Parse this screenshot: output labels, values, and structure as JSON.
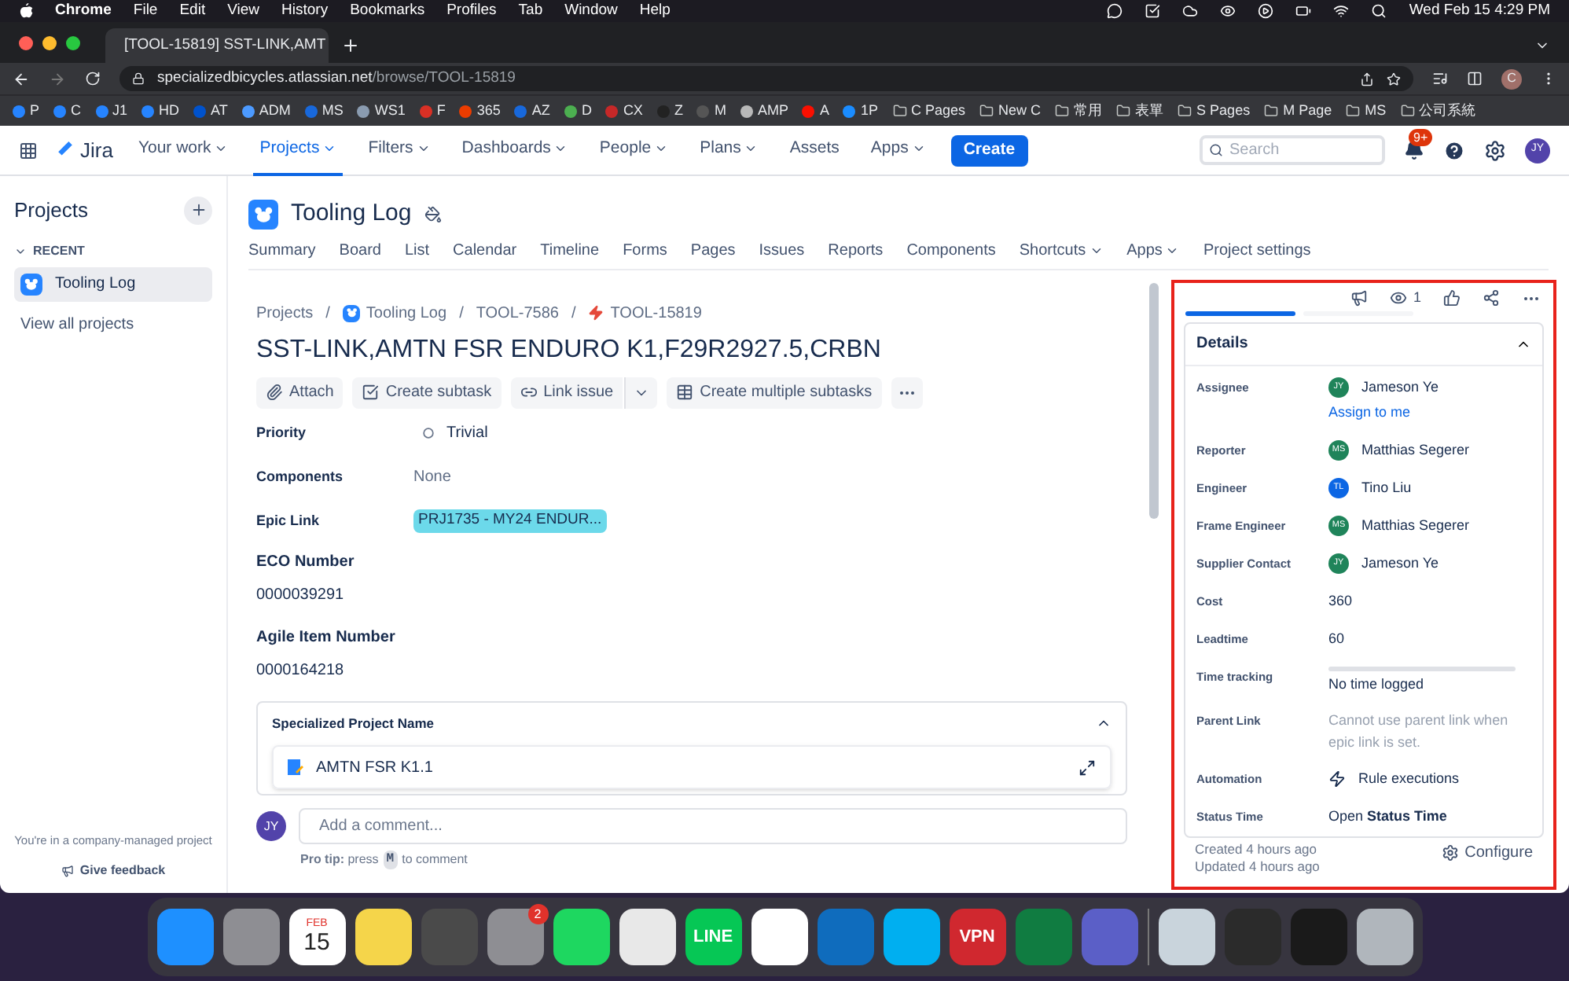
{
  "menu_bar": {
    "items": [
      "Chrome",
      "File",
      "Edit",
      "View",
      "History",
      "Bookmarks",
      "Profiles",
      "Tab",
      "Window",
      "Help"
    ],
    "clock": "Wed Feb 15  4:29 PM"
  },
  "browser": {
    "tab_title": "[TOOL-15819] SST-LINK,AMT",
    "url_host": "specializedbicycles.atlassian.net",
    "url_path": "/browse/TOOL-15819",
    "profile": "C",
    "bookmarks": [
      {
        "label": "P",
        "kind": "app",
        "color": "#2684ff"
      },
      {
        "label": "C",
        "kind": "app",
        "color": "#2684ff"
      },
      {
        "label": "J1",
        "kind": "app",
        "color": "#2684ff"
      },
      {
        "label": "HD",
        "kind": "app",
        "color": "#2684ff"
      },
      {
        "label": "AT",
        "kind": "app",
        "color": "#0052cc"
      },
      {
        "label": "ADM",
        "kind": "app",
        "color": "#4c9aff"
      },
      {
        "label": "MS",
        "kind": "app",
        "color": "#1868db"
      },
      {
        "label": "WS1",
        "kind": "app",
        "color": "#8a9bb0"
      },
      {
        "label": "F",
        "kind": "app",
        "color": "#d93025"
      },
      {
        "label": "365",
        "kind": "app",
        "color": "#eb3c00"
      },
      {
        "label": "AZ",
        "kind": "app",
        "color": "#1868db"
      },
      {
        "label": "D",
        "kind": "app",
        "color": "#4caf50"
      },
      {
        "label": "CX",
        "kind": "app",
        "color": "#c62828"
      },
      {
        "label": "Z",
        "kind": "app",
        "color": "#222222"
      },
      {
        "label": "M",
        "kind": "app",
        "color": "#555555"
      },
      {
        "label": "AMP",
        "kind": "app",
        "color": "#b8b8b8"
      },
      {
        "label": "A",
        "kind": "app",
        "color": "#fa0f00"
      },
      {
        "label": "1P",
        "kind": "app",
        "color": "#1a8cff"
      },
      {
        "label": "C Pages",
        "kind": "folder"
      },
      {
        "label": "New C",
        "kind": "folder"
      },
      {
        "label": "常用",
        "kind": "folder"
      },
      {
        "label": "表單",
        "kind": "folder"
      },
      {
        "label": "S Pages",
        "kind": "folder"
      },
      {
        "label": "M Page",
        "kind": "folder"
      },
      {
        "label": "MS",
        "kind": "folder"
      },
      {
        "label": "公司系統",
        "kind": "folder"
      }
    ]
  },
  "jira_nav": {
    "product": "Jira",
    "items": [
      {
        "label": "Your work",
        "dropdown": true,
        "selected": false
      },
      {
        "label": "Projects",
        "dropdown": true,
        "selected": true
      },
      {
        "label": "Filters",
        "dropdown": true,
        "selected": false
      },
      {
        "label": "Dashboards",
        "dropdown": true,
        "selected": false
      },
      {
        "label": "People",
        "dropdown": true,
        "selected": false
      },
      {
        "label": "Plans",
        "dropdown": true,
        "selected": false
      },
      {
        "label": "Assets",
        "dropdown": false,
        "selected": false
      },
      {
        "label": "Apps",
        "dropdown": true,
        "selected": false
      }
    ],
    "create": "Create",
    "search_placeholder": "Search",
    "notifications": "9+",
    "avatar": "JY"
  },
  "sidebar": {
    "title": "Projects",
    "section": "RECENT",
    "items": [
      {
        "label": "Tooling Log",
        "selected": true
      }
    ],
    "view_all": "View all projects",
    "footer_note": "You're in a company-managed project",
    "feedback": "Give feedback"
  },
  "project": {
    "name": "Tooling Log",
    "tabs": [
      {
        "label": "Summary",
        "dropdown": false
      },
      {
        "label": "Board",
        "dropdown": false
      },
      {
        "label": "List",
        "dropdown": false
      },
      {
        "label": "Calendar",
        "dropdown": false
      },
      {
        "label": "Timeline",
        "dropdown": false
      },
      {
        "label": "Forms",
        "dropdown": false
      },
      {
        "label": "Pages",
        "dropdown": false
      },
      {
        "label": "Issues",
        "dropdown": false
      },
      {
        "label": "Reports",
        "dropdown": false
      },
      {
        "label": "Components",
        "dropdown": false
      },
      {
        "label": "Shortcuts",
        "dropdown": true
      },
      {
        "label": "Apps",
        "dropdown": true
      },
      {
        "label": "Project settings",
        "dropdown": false
      }
    ]
  },
  "issue": {
    "breadcrumb_separator": "/",
    "breadcrumbs": [
      {
        "label": "Projects",
        "kind": "text"
      },
      {
        "label": "Tooling Log",
        "kind": "project"
      },
      {
        "label": "TOOL-7586",
        "kind": "text"
      },
      {
        "label": "TOOL-15819",
        "kind": "issue"
      }
    ],
    "title": "SST-LINK,AMTN FSR ENDURO K1,F29R2927.5,CRBN",
    "actions": [
      {
        "label": "Attach",
        "kind": "attach"
      },
      {
        "label": "Create subtask",
        "kind": "subtask"
      },
      {
        "label": "Link issue",
        "kind": "link"
      },
      {
        "label": "Create multiple subtasks",
        "kind": "multi"
      }
    ],
    "fields": [
      {
        "label": "Priority",
        "value": "Trivial",
        "kind": "priority"
      },
      {
        "label": "Components",
        "value": "None",
        "kind": "muted"
      },
      {
        "label": "Epic Link",
        "value": "PRJ1735 - MY24 ENDUR...",
        "kind": "tag",
        "color": "#6cd9ea"
      }
    ],
    "sections": [
      {
        "label": "ECO Number",
        "value": "0000039291"
      },
      {
        "label": "Agile Item Number",
        "value": "0000164218"
      }
    ],
    "panel": {
      "title": "Specialized Project Name",
      "expanded": true,
      "item": "AMTN FSR K1.1"
    },
    "comment": {
      "avatar": "JY",
      "placeholder": "Add a comment...",
      "tip": "**Pro tip:** press",
      "key": "M",
      "tip_end": "to comment"
    }
  },
  "details": {
    "watchers": "1",
    "tabs": [
      {
        "selected": true
      },
      {
        "selected": false
      }
    ],
    "title": "Details",
    "expanded": true,
    "rows": [
      {
        "label": "Assignee",
        "kind": "person",
        "value": "Jameson Ye",
        "initials": "JY",
        "color": "#1f845a",
        "link": "Assign to me"
      },
      {
        "label": "Reporter",
        "kind": "person",
        "value": "Matthias Segerer",
        "initials": "MS",
        "color": "#1f845a"
      },
      {
        "label": "Engineer",
        "kind": "person",
        "value": "Tino Liu",
        "initials": "TL",
        "color": "#0c66e4"
      },
      {
        "label": "Frame Engineer",
        "kind": "person",
        "value": "Matthias Segerer",
        "initials": "MS",
        "color": "#1f845a"
      },
      {
        "label": "Supplier Contact",
        "kind": "person",
        "value": "Jameson Ye",
        "initials": "JY",
        "color": "#1f845a"
      },
      {
        "label": "Cost",
        "kind": "text",
        "value": "360"
      },
      {
        "label": "Leadtime",
        "kind": "text",
        "value": "60"
      },
      {
        "label": "Time tracking",
        "kind": "tracking",
        "value": "No time logged",
        "level": 0
      },
      {
        "label": "Parent Link",
        "kind": "muted",
        "value": "Cannot use parent link when epic link is set."
      },
      {
        "label": "Automation",
        "kind": "automation",
        "value": "Rule executions"
      },
      {
        "label": "Status Time",
        "kind": "text",
        "value": "Open **Status Time**"
      }
    ],
    "created": "Created 4 hours ago",
    "updated": "Updated 4 hours ago",
    "configure": "Configure"
  },
  "dock": [
    {
      "kind": "app",
      "color": "#1e90ff"
    },
    {
      "kind": "app",
      "color": "#8e8e93"
    },
    {
      "kind": "calendar",
      "color": "#ffffff",
      "month": "FEB",
      "day": "15"
    },
    {
      "kind": "app",
      "color": "#f5d54a"
    },
    {
      "kind": "app",
      "color": "#4a4a4a"
    },
    {
      "kind": "app",
      "color": "#8e8e93",
      "badge": "2"
    },
    {
      "kind": "app",
      "color": "#1ed760"
    },
    {
      "kind": "app",
      "color": "#e8e8e8"
    },
    {
      "kind": "text",
      "color": "#06c755",
      "text": "LINE"
    },
    {
      "kind": "app",
      "color": "#ffffff"
    },
    {
      "kind": "app",
      "color": "#0f6cbd"
    },
    {
      "kind": "app",
      "color": "#00aff0"
    },
    {
      "kind": "text",
      "color": "#d0282f",
      "text": "VPN"
    },
    {
      "kind": "app",
      "color": "#107c41"
    },
    {
      "kind": "app",
      "color": "#5b5fc7"
    },
    {
      "kind": "separator"
    },
    {
      "kind": "app",
      "color": "#c9d4dc"
    },
    {
      "kind": "app",
      "color": "#2b2b2b"
    },
    {
      "kind": "app",
      "color": "#1a1a1a"
    },
    {
      "kind": "app",
      "color": "#b0b6bc"
    }
  ]
}
